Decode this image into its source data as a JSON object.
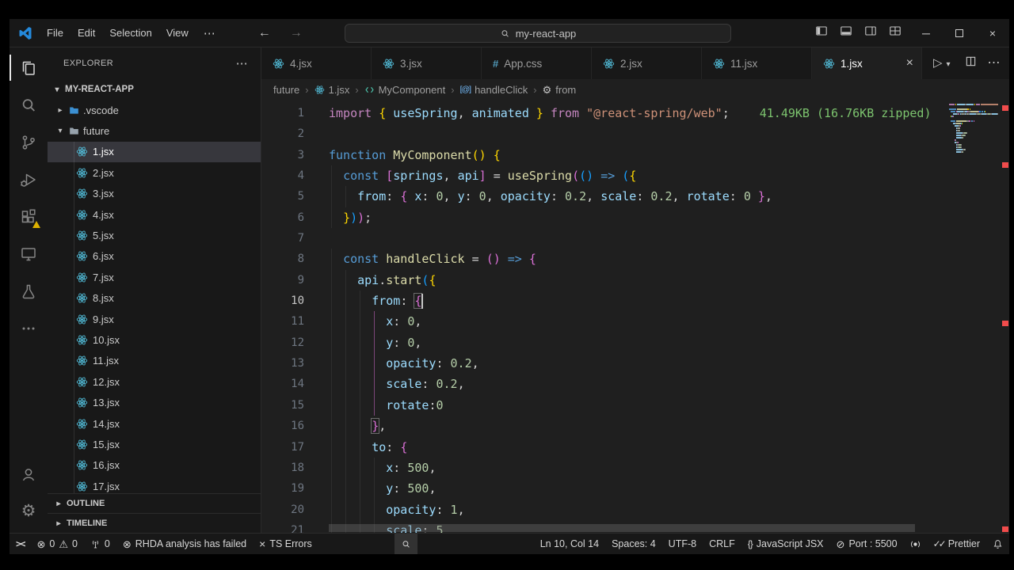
{
  "window": {
    "menus": [
      "File",
      "Edit",
      "Selection",
      "View"
    ],
    "menu_more": "⋯",
    "back": "←",
    "forward": "→",
    "command_center": "my-react-app",
    "minimize": "─",
    "close": "×"
  },
  "activity_bar": {
    "top": [
      {
        "name": "explorer",
        "icon": "files-icon",
        "active": true
      },
      {
        "name": "search",
        "icon": "search-icon"
      },
      {
        "name": "source-control",
        "icon": "source-control-icon"
      },
      {
        "name": "run-debug",
        "icon": "run-debug-icon"
      },
      {
        "name": "extensions",
        "icon": "extensions-icon",
        "badge": "warning"
      },
      {
        "name": "remote-explorer",
        "icon": "remote-explorer-icon"
      },
      {
        "name": "testing",
        "icon": "testing-icon"
      },
      {
        "name": "more",
        "icon": "more-icon"
      }
    ],
    "bottom": [
      {
        "name": "accounts",
        "icon": "account-icon"
      },
      {
        "name": "settings",
        "icon": "gear-icon"
      }
    ]
  },
  "sidebar": {
    "title": "EXPLORER",
    "header_more": "⋯",
    "project": "MY-REACT-APP",
    "folders": [
      {
        "name": ".vscode",
        "icon": "vscode-folder-icon",
        "expanded": false
      },
      {
        "name": "future",
        "icon": "folder-icon",
        "expanded": true
      }
    ],
    "files": [
      "1.jsx",
      "2.jsx",
      "3.jsx",
      "4.jsx",
      "5.jsx",
      "6.jsx",
      "7.jsx",
      "8.jsx",
      "9.jsx",
      "10.jsx",
      "11.jsx",
      "12.jsx",
      "13.jsx",
      "14.jsx",
      "15.jsx",
      "16.jsx",
      "17.jsx"
    ],
    "selected_file": "1.jsx",
    "sections": [
      "OUTLINE",
      "TIMELINE"
    ]
  },
  "tabs": [
    {
      "label": "4.jsx",
      "icon": "react-icon"
    },
    {
      "label": "3.jsx",
      "icon": "react-icon"
    },
    {
      "label": "App.css",
      "icon": "css-icon"
    },
    {
      "label": "2.jsx",
      "icon": "react-icon"
    },
    {
      "label": "11.jsx",
      "icon": "react-icon"
    },
    {
      "label": "1.jsx",
      "icon": "react-icon",
      "active": true
    }
  ],
  "editor_actions": [
    {
      "name": "run",
      "icon": "play-icon"
    },
    {
      "name": "run-dropdown",
      "icon": "chevron-down-icon"
    },
    {
      "name": "split-editor",
      "icon": "split-icon"
    },
    {
      "name": "more-actions",
      "icon": "more-h-icon"
    }
  ],
  "breadcrumbs": [
    {
      "label": "future"
    },
    {
      "label": "1.jsx",
      "icon": "react-icon"
    },
    {
      "label": "MyComponent",
      "icon": "symbol-component-icon"
    },
    {
      "label": "handleClick",
      "icon": "symbol-method-icon"
    },
    {
      "label": "from",
      "icon": "symbol-property-icon"
    }
  ],
  "editor": {
    "cursor": {
      "line": 10,
      "col": 14
    },
    "annotation": {
      "line": 1,
      "text": "41.49KB (16.76KB zipped)"
    },
    "bracket_guide": {
      "from_line": 11,
      "to_line": 15,
      "level": 3
    },
    "error_marks": [
      0.012,
      0.145,
      0.51,
      0.985
    ],
    "lines": [
      {
        "n": 1,
        "t": [
          [
            "kw1",
            "import"
          ],
          [
            "pun",
            " "
          ],
          [
            "b1",
            "{"
          ],
          [
            "pun",
            " "
          ],
          [
            "var",
            "useSpring"
          ],
          [
            "pun",
            ", "
          ],
          [
            "var",
            "animated"
          ],
          [
            "pun",
            " "
          ],
          [
            "b1",
            "}"
          ],
          [
            "pun",
            " "
          ],
          [
            "kw1",
            "from"
          ],
          [
            "pun",
            " "
          ],
          [
            "str",
            "\"@react-spring/web\""
          ],
          [
            "pun",
            ";"
          ]
        ]
      },
      {
        "n": 2,
        "t": []
      },
      {
        "n": 3,
        "t": [
          [
            "kw2",
            "function"
          ],
          [
            "pun",
            " "
          ],
          [
            "fn",
            "MyComponent"
          ],
          [
            "b1",
            "()"
          ],
          [
            "pun",
            " "
          ],
          [
            "b1",
            "{"
          ]
        ]
      },
      {
        "n": 4,
        "t": [
          [
            "pun",
            "  "
          ],
          [
            "kw2",
            "const"
          ],
          [
            "pun",
            " "
          ],
          [
            "b2",
            "["
          ],
          [
            "var",
            "springs"
          ],
          [
            "pun",
            ", "
          ],
          [
            "var",
            "api"
          ],
          [
            "b2",
            "]"
          ],
          [
            "pun",
            " = "
          ],
          [
            "fn",
            "useSpring"
          ],
          [
            "b2",
            "("
          ],
          [
            "b3",
            "()"
          ],
          [
            "pun",
            " "
          ],
          [
            "kw2",
            "=>"
          ],
          [
            "pun",
            " "
          ],
          [
            "b3",
            "("
          ],
          [
            "b1",
            "{"
          ]
        ]
      },
      {
        "n": 5,
        "t": [
          [
            "pun",
            "    "
          ],
          [
            "var",
            "from"
          ],
          [
            "pun",
            ": "
          ],
          [
            "b2",
            "{"
          ],
          [
            "pun",
            " "
          ],
          [
            "var",
            "x"
          ],
          [
            "pun",
            ": "
          ],
          [
            "num",
            "0"
          ],
          [
            "pun",
            ", "
          ],
          [
            "var",
            "y"
          ],
          [
            "pun",
            ": "
          ],
          [
            "num",
            "0"
          ],
          [
            "pun",
            ", "
          ],
          [
            "var",
            "opacity"
          ],
          [
            "pun",
            ": "
          ],
          [
            "num",
            "0.2"
          ],
          [
            "pun",
            ", "
          ],
          [
            "var",
            "scale"
          ],
          [
            "pun",
            ": "
          ],
          [
            "num",
            "0.2"
          ],
          [
            "pun",
            ", "
          ],
          [
            "var",
            "rotate"
          ],
          [
            "pun",
            ": "
          ],
          [
            "num",
            "0"
          ],
          [
            "pun",
            " "
          ],
          [
            "b2",
            "}"
          ],
          [
            "pun",
            ","
          ]
        ]
      },
      {
        "n": 6,
        "t": [
          [
            "pun",
            "  "
          ],
          [
            "b1",
            "}"
          ],
          [
            "b3",
            ")"
          ],
          [
            "b2",
            ")"
          ],
          [
            "pun",
            ";"
          ]
        ]
      },
      {
        "n": 7,
        "t": []
      },
      {
        "n": 8,
        "t": [
          [
            "pun",
            "  "
          ],
          [
            "kw2",
            "const"
          ],
          [
            "pun",
            " "
          ],
          [
            "fn",
            "handleClick"
          ],
          [
            "pun",
            " = "
          ],
          [
            "b2",
            "()"
          ],
          [
            "pun",
            " "
          ],
          [
            "kw2",
            "=>"
          ],
          [
            "pun",
            " "
          ],
          [
            "b2",
            "{"
          ]
        ]
      },
      {
        "n": 9,
        "t": [
          [
            "pun",
            "    "
          ],
          [
            "var",
            "api"
          ],
          [
            "pun",
            "."
          ],
          [
            "fn",
            "start"
          ],
          [
            "b3",
            "("
          ],
          [
            "b1",
            "{"
          ]
        ]
      },
      {
        "n": 10,
        "t": [
          [
            "pun",
            "      "
          ],
          [
            "var",
            "from"
          ],
          [
            "pun",
            ": "
          ],
          [
            "b2",
            "{",
            "m"
          ]
        ]
      },
      {
        "n": 11,
        "t": [
          [
            "pun",
            "        "
          ],
          [
            "var",
            "x"
          ],
          [
            "pun",
            ": "
          ],
          [
            "num",
            "0"
          ],
          [
            "pun",
            ","
          ]
        ]
      },
      {
        "n": 12,
        "t": [
          [
            "pun",
            "        "
          ],
          [
            "var",
            "y"
          ],
          [
            "pun",
            ": "
          ],
          [
            "num",
            "0"
          ],
          [
            "pun",
            ","
          ]
        ]
      },
      {
        "n": 13,
        "t": [
          [
            "pun",
            "        "
          ],
          [
            "var",
            "opacity"
          ],
          [
            "pun",
            ": "
          ],
          [
            "num",
            "0.2"
          ],
          [
            "pun",
            ","
          ]
        ]
      },
      {
        "n": 14,
        "t": [
          [
            "pun",
            "        "
          ],
          [
            "var",
            "scale"
          ],
          [
            "pun",
            ": "
          ],
          [
            "num",
            "0.2"
          ],
          [
            "pun",
            ","
          ]
        ]
      },
      {
        "n": 15,
        "t": [
          [
            "pun",
            "        "
          ],
          [
            "var",
            "rotate"
          ],
          [
            "pun",
            ":"
          ],
          [
            "num",
            "0"
          ]
        ]
      },
      {
        "n": 16,
        "t": [
          [
            "pun",
            "      "
          ],
          [
            "b2",
            "}",
            "m"
          ],
          [
            "pun",
            ","
          ]
        ]
      },
      {
        "n": 17,
        "t": [
          [
            "pun",
            "      "
          ],
          [
            "var",
            "to"
          ],
          [
            "pun",
            ": "
          ],
          [
            "b2",
            "{"
          ]
        ]
      },
      {
        "n": 18,
        "t": [
          [
            "pun",
            "        "
          ],
          [
            "var",
            "x"
          ],
          [
            "pun",
            ": "
          ],
          [
            "num",
            "500"
          ],
          [
            "pun",
            ","
          ]
        ]
      },
      {
        "n": 19,
        "t": [
          [
            "pun",
            "        "
          ],
          [
            "var",
            "y"
          ],
          [
            "pun",
            ": "
          ],
          [
            "num",
            "500"
          ],
          [
            "pun",
            ","
          ]
        ]
      },
      {
        "n": 20,
        "t": [
          [
            "pun",
            "        "
          ],
          [
            "var",
            "opacity"
          ],
          [
            "pun",
            ": "
          ],
          [
            "num",
            "1"
          ],
          [
            "pun",
            ","
          ]
        ]
      },
      {
        "n": 21,
        "t": [
          [
            "pun",
            "        "
          ],
          [
            "var",
            "scale"
          ],
          [
            "pun",
            ": "
          ],
          [
            "num",
            "5"
          ]
        ]
      }
    ]
  },
  "status_bar": {
    "left": [
      {
        "name": "remote",
        "parts": [
          {
            "i": "remote-icon"
          }
        ]
      },
      {
        "name": "problems",
        "parts": [
          {
            "i": "error-icon"
          },
          {
            "t": "0"
          },
          {
            "i": "warning-icon"
          },
          {
            "t": "0"
          }
        ]
      },
      {
        "name": "ports",
        "parts": [
          {
            "i": "radio-tower-icon"
          },
          {
            "t": "0"
          }
        ]
      },
      {
        "name": "rhda",
        "parts": [
          {
            "i": "error-icon"
          },
          {
            "t": "RHDA analysis has failed"
          }
        ]
      },
      {
        "name": "ts-errors",
        "parts": [
          {
            "i": "close-icon"
          },
          {
            "t": "TS Errors"
          }
        ]
      },
      {
        "name": "search",
        "boxed": true,
        "gap": true,
        "parts": [
          {
            "i": "search-icon"
          }
        ]
      }
    ],
    "right": [
      {
        "name": "cursor-position",
        "parts": [
          {
            "t": "Ln 10, Col 14"
          }
        ]
      },
      {
        "name": "indentation",
        "parts": [
          {
            "t": "Spaces: 4"
          }
        ]
      },
      {
        "name": "encoding",
        "parts": [
          {
            "t": "UTF-8"
          }
        ]
      },
      {
        "name": "eol",
        "parts": [
          {
            "t": "CRLF"
          }
        ]
      },
      {
        "name": "language-mode",
        "parts": [
          {
            "i": "braces-icon"
          },
          {
            "t": "JavaScript JSX"
          }
        ]
      },
      {
        "name": "port",
        "parts": [
          {
            "i": "circle-slash-icon"
          },
          {
            "t": "Port : 5500"
          }
        ]
      },
      {
        "name": "broadcast",
        "parts": [
          {
            "i": "broadcast-icon"
          }
        ]
      },
      {
        "name": "prettier",
        "parts": [
          {
            "i": "check-all-icon"
          },
          {
            "t": "Prettier"
          }
        ]
      },
      {
        "name": "notifications",
        "parts": [
          {
            "i": "bell-icon"
          }
        ]
      }
    ]
  },
  "colors": {
    "react_blue": "#53c1de",
    "annotation_green": "#7cc36e",
    "error_red": "#f14c4c",
    "warning_yellow": "#ddb100"
  }
}
